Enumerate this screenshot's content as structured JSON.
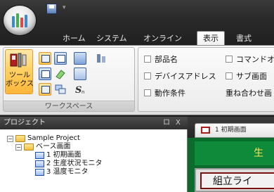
{
  "colors": {
    "ribbon_dark": "#2a2a2a",
    "accent_orange": "#ffc247",
    "screen_green": "#0a6b2d",
    "title_yellow": "#ffe25a",
    "logo_bars": [
      "#3c8ad6",
      "#43b14b",
      "#e04646",
      "#3c8ad6"
    ]
  },
  "quick_access": {
    "separator": "▾"
  },
  "tabs": [
    {
      "label": "ホーム"
    },
    {
      "label": "システム"
    },
    {
      "label": "オンライン"
    },
    {
      "label": "表示",
      "active": true
    },
    {
      "label": "書式"
    }
  ],
  "ribbon": {
    "workspace": {
      "toolbox_label_1": "ツール",
      "toolbox_label_2": "ボックス",
      "group_label": "ワークスペース",
      "icons": [
        "window-layout-icon",
        "window-split-icon",
        "screen-list-icon",
        "align-icon",
        "window-list-icon",
        "eraser-icon",
        "grid-icon",
        "screen-small-icon",
        "cascade-icon",
        "script-icon"
      ]
    },
    "display": {
      "checkboxes": [
        {
          "label": "部品名"
        },
        {
          "label": "デバイスアドレス"
        },
        {
          "label": "動作条件"
        }
      ],
      "checkboxes_col2": [
        {
          "label": "コマンドオ"
        },
        {
          "label": "サブ画面"
        }
      ],
      "overlay_label": "重ね合わせ画"
    }
  },
  "project_pane": {
    "title": "プロジェクト",
    "pin": "ロ",
    "close": "X",
    "tree": {
      "root": "Sample Project",
      "base_folder": "ベース画面",
      "screens": [
        "1 初期画面",
        "2 生産状況モニタ",
        "3 温度モニタ"
      ]
    },
    "expander_minus": "−"
  },
  "screen_editor": {
    "tab_label": "1 初期画面",
    "title_text": "生",
    "panel_text": "組立ライ"
  }
}
